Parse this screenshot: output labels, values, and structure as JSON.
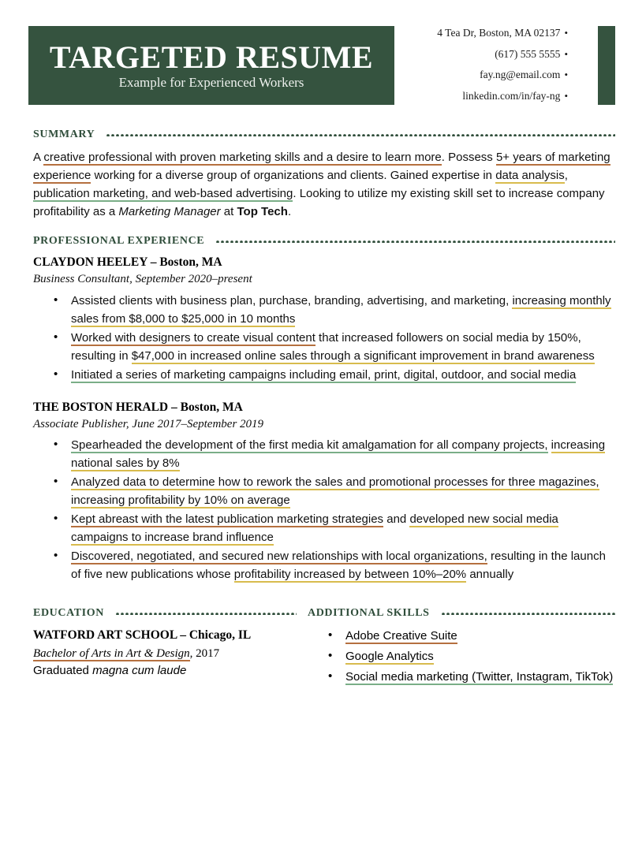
{
  "header": {
    "name_title": "TARGETED RESUME",
    "subtitle": "Example for Experienced Workers",
    "contact": [
      "4 Tea Dr, Boston, MA 02137",
      "(617) 555 5555",
      "fay.ng@email.com",
      "linkedin.com/in/fay-ng"
    ],
    "contact_bullet": "•"
  },
  "colors": {
    "brand_green": "#35533f",
    "heading_green": "#2f4d3a",
    "highlight_orange": "#b5703f",
    "highlight_yellow": "#d8bb4d",
    "highlight_green": "#7aae87"
  },
  "sections": {
    "summary": {
      "label": "SUMMARY"
    },
    "experience": {
      "label": "PROFESSIONAL EXPERIENCE"
    },
    "education": {
      "label": "EDUCATION"
    },
    "skills": {
      "label": "ADDITIONAL SKILLS"
    }
  },
  "summary": {
    "p1": "A ",
    "h_orange_1": "creative professional with proven marketing skills and a desire to learn more",
    "p2": ". Possess ",
    "h_orange_2": "5+ years of marketing experience",
    "p3": " working for a diverse group of organizations and clients. Gained expertise in ",
    "h_yellow_1": "data analysis",
    "p4": ", ",
    "h_green_1": "publication marketing, and web-based advertising",
    "p5": ". Looking to utilize my existing skill set to increase company profitability as a ",
    "italic_1": "Marketing Manager",
    "p6": " at ",
    "bold_1": "Top Tech",
    "p7": "."
  },
  "jobs": [
    {
      "company": "CLAYDON HEELEY – Boston, MA",
      "title": "Business Consultant, September 2020–present",
      "bullets": [
        {
          "parts": [
            {
              "text": "Assisted clients with business plan, purchase, branding, advertising, and marketing, ",
              "hl": "none"
            },
            {
              "text": "increasing monthly sales from $8,000 to $25,000 in 10 months",
              "hl": "yellow"
            }
          ]
        },
        {
          "parts": [
            {
              "text": "Worked with designers to create visual content",
              "hl": "orange"
            },
            {
              "text": " that increased followers on social media by 150%, resulting in ",
              "hl": "none"
            },
            {
              "text": "$47,000 in increased online sales through a significant improvement in brand awareness",
              "hl": "yellow"
            }
          ]
        },
        {
          "parts": [
            {
              "text": "Initiated a series of marketing campaigns including email, print, digital, outdoor, and social media",
              "hl": "green"
            }
          ]
        }
      ]
    },
    {
      "company": "THE BOSTON HERALD – Boston, MA",
      "title": "Associate Publisher, June 2017–September 2019",
      "bullets": [
        {
          "parts": [
            {
              "text": "Spearheaded the development of the first media kit amalgamation for all company projects,",
              "hl": "green"
            },
            {
              "text": " ",
              "hl": "none"
            },
            {
              "text": "increasing national sales by 8%",
              "hl": "yellow"
            }
          ]
        },
        {
          "parts": [
            {
              "text": "Analyzed data to determine how to rework the sales and promotional processes for three magazines, increasing profitability by 10% on average",
              "hl": "yellow"
            }
          ]
        },
        {
          "parts": [
            {
              "text": "Kept abreast with the latest publication marketing strategies",
              "hl": "orange"
            },
            {
              "text": " and ",
              "hl": "none"
            },
            {
              "text": "developed new social media campaigns to increase brand influence",
              "hl": "yellow"
            }
          ]
        },
        {
          "parts": [
            {
              "text": "Discovered, negotiated, and secured new relationships with local organizations,",
              "hl": "orange"
            },
            {
              "text": " resulting in the launch of five new publications whose ",
              "hl": "none"
            },
            {
              "text": "profitability increased by between 10%–20%",
              "hl": "yellow"
            },
            {
              "text": " annually",
              "hl": "none"
            }
          ]
        }
      ]
    }
  ],
  "education": {
    "school": "WATFORD ART SCHOOL – Chicago, IL",
    "degree_highlight": "Bachelor of Arts in Art & Design",
    "degree_year": ", 2017",
    "note_plain": "Graduated ",
    "note_italic": "magna cum laude"
  },
  "skills": [
    {
      "text": "Adobe Creative Suite",
      "hl": "orange"
    },
    {
      "text": "Google Analytics",
      "hl": "yellow"
    },
    {
      "text": "Social media marketing (Twitter, Instagram, TikTok)",
      "hl": "green"
    }
  ]
}
